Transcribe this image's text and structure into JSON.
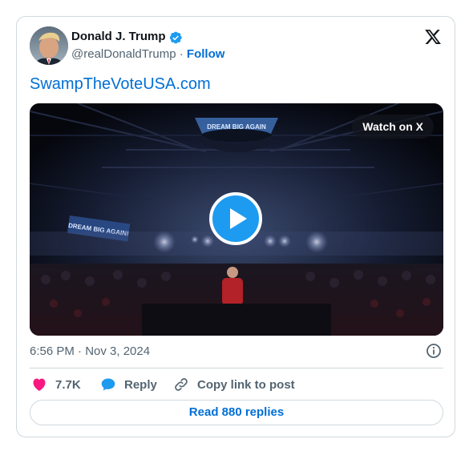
{
  "author": {
    "name": "Donald J. Trump",
    "handle": "@realDonaldTrump",
    "separator": "·",
    "follow_label": "Follow"
  },
  "tweet": {
    "link_text": "SwampTheVoteUSA.com",
    "timestamp": "6:56 PM · Nov 3, 2024"
  },
  "media": {
    "watch_label": "Watch on X",
    "banner_text": "DREAM BIG AGAIN!",
    "ring_text": "DREAM BIG AGAIN"
  },
  "actions": {
    "likes": "7.7K",
    "reply_label": "Reply",
    "copy_label": "Copy link to post"
  },
  "footer": {
    "read_replies": "Read 880 replies"
  },
  "colors": {
    "accent": "#006fd6",
    "like": "#f91880",
    "verified": "#1d9bf0",
    "muted": "#536471",
    "border": "#cfd9de"
  },
  "icons": [
    "verified-badge-icon",
    "x-logo-icon",
    "play-icon",
    "info-icon",
    "heart-icon",
    "reply-bubble-icon",
    "link-icon"
  ]
}
